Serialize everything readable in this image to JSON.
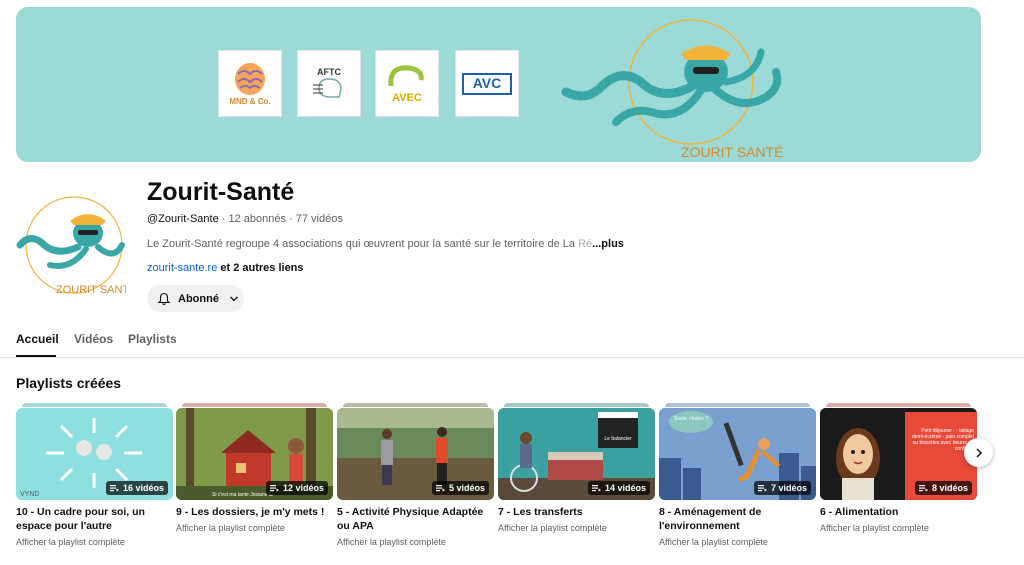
{
  "banner": {
    "logos": [
      {
        "name": "mnd-logo",
        "label": "MND & Co."
      },
      {
        "name": "aftc-logo",
        "label": "AFTC"
      },
      {
        "name": "collectif-avec-logo",
        "label": "AVEC"
      },
      {
        "name": "france-avc-logo",
        "label": "AVC"
      }
    ],
    "mascot_text": "ZOURIT SANTÉ",
    "colors": {
      "background": "#9bdad6",
      "octopus": "#3aa7a7",
      "hat": "#f2b33a"
    }
  },
  "channel": {
    "name": "Zourit-Santé",
    "handle": "@Zourit-Sante",
    "stats": " · 12 abonnés · 77 vidéos",
    "description": "Le Zourit-Santé regroupe 4 associations qui œuvrent pour la santé sur le territoire de La ",
    "description_fade": "Ré",
    "more": "...plus",
    "link": "zourit-sante.re",
    "other_links": " et 2 autres liens",
    "avatar_text": "ZOURIT SANTÉ"
  },
  "subscribe": {
    "label": "Abonné",
    "icon": "bell-icon"
  },
  "tabs": [
    {
      "label": "Accueil",
      "active": true
    },
    {
      "label": "Vidéos",
      "active": false
    },
    {
      "label": "Playlists",
      "active": false
    }
  ],
  "section": {
    "title": "Playlists créées"
  },
  "playlists": [
    {
      "title": "10 - Un cadre pour soi, un espace pour l'autre",
      "count": "16 vidéos",
      "link": "Afficher la playlist complète"
    },
    {
      "title": "9 - Les dossiers, je m'y mets !",
      "count": "12 vidéos",
      "link": "Afficher la playlist complète"
    },
    {
      "title": "5 - Activité Physique Adaptée ou APA",
      "count": "5 vidéos",
      "link": "Afficher la playlist complète"
    },
    {
      "title": "7 - Les transferts",
      "count": "14 vidéos",
      "link": "Afficher la playlist complète"
    },
    {
      "title": "8 - Aménagement de l'environnement",
      "count": "7 vidéos",
      "link": "Afficher la playlist complète"
    },
    {
      "title": "6 - Alimentation",
      "count": "8 vidéos",
      "link": "Afficher la playlist complète"
    }
  ],
  "thumb_texts": {
    "t2_caption": "Si c'est ma tante Josiane lu",
    "t4_clapper": "Le balancier",
    "t5_bubble": "Suzie, chutes ?",
    "t6_bubble": "Petit déjeuner : - laitage demi-écrémé - pain complet ou biscottes avec beurre ou confiture"
  }
}
